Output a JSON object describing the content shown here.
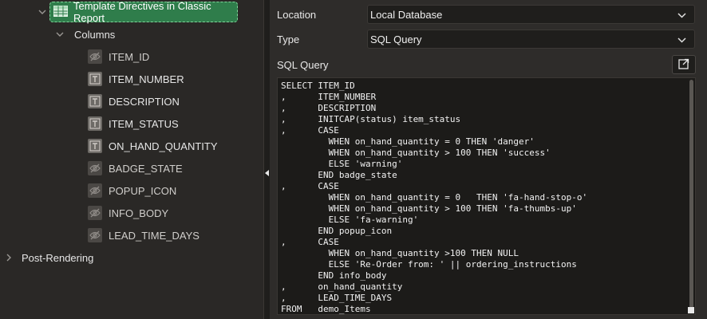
{
  "tree": {
    "selected_node": "Template Directives in Classic Report",
    "group_label": "Columns",
    "columns": [
      {
        "label": "ITEM_ID",
        "type": "hidden",
        "icon": "eye-slash-icon"
      },
      {
        "label": "ITEM_NUMBER",
        "type": "plain-text",
        "icon": "text-column-icon"
      },
      {
        "label": "DESCRIPTION",
        "type": "plain-text",
        "icon": "text-column-icon"
      },
      {
        "label": "ITEM_STATUS",
        "type": "plain-text",
        "icon": "text-column-icon"
      },
      {
        "label": "ON_HAND_QUANTITY",
        "type": "plain-text",
        "icon": "text-column-icon"
      },
      {
        "label": "BADGE_STATE",
        "type": "hidden",
        "icon": "eye-slash-icon"
      },
      {
        "label": "POPUP_ICON",
        "type": "hidden",
        "icon": "eye-slash-icon"
      },
      {
        "label": "INFO_BODY",
        "type": "hidden",
        "icon": "eye-slash-icon"
      },
      {
        "label": "LEAD_TIME_DAYS",
        "type": "hidden",
        "icon": "eye-slash-icon"
      }
    ],
    "post_rendering_label": "Post-Rendering"
  },
  "props": {
    "location_label": "Location",
    "location_value": "Local Database",
    "type_label": "Type",
    "type_value": "SQL Query",
    "sql_label": "SQL Query",
    "sql_lines": [
      "SELECT ITEM_ID",
      ",      ITEM_NUMBER",
      ",      DESCRIPTION",
      ",      INITCAP(status) item_status",
      ",      CASE",
      "         WHEN on_hand_quantity = 0 THEN 'danger'",
      "         WHEN on_hand_quantity > 100 THEN 'success'",
      "         ELSE 'warning'",
      "       END badge_state",
      ",      CASE",
      "         WHEN on_hand_quantity = 0   THEN 'fa-hand-stop-o'",
      "         WHEN on_hand_quantity > 100 THEN 'fa-thumbs-up'",
      "         ELSE 'fa-warning'",
      "       END popup_icon",
      ",      CASE",
      "         WHEN on_hand_quantity >100 THEN NULL",
      "         ELSE 'Re-Order from: ' || ordering_instructions",
      "       END info_body",
      ",      on_hand_quantity",
      ",      LEAD_TIME_DAYS",
      "FROM   demo_Items"
    ]
  },
  "colors": {
    "selected_bg": "#2f7d4b",
    "panel_bg": "#2e2c2a",
    "editor_bg": "#1c1b19"
  }
}
